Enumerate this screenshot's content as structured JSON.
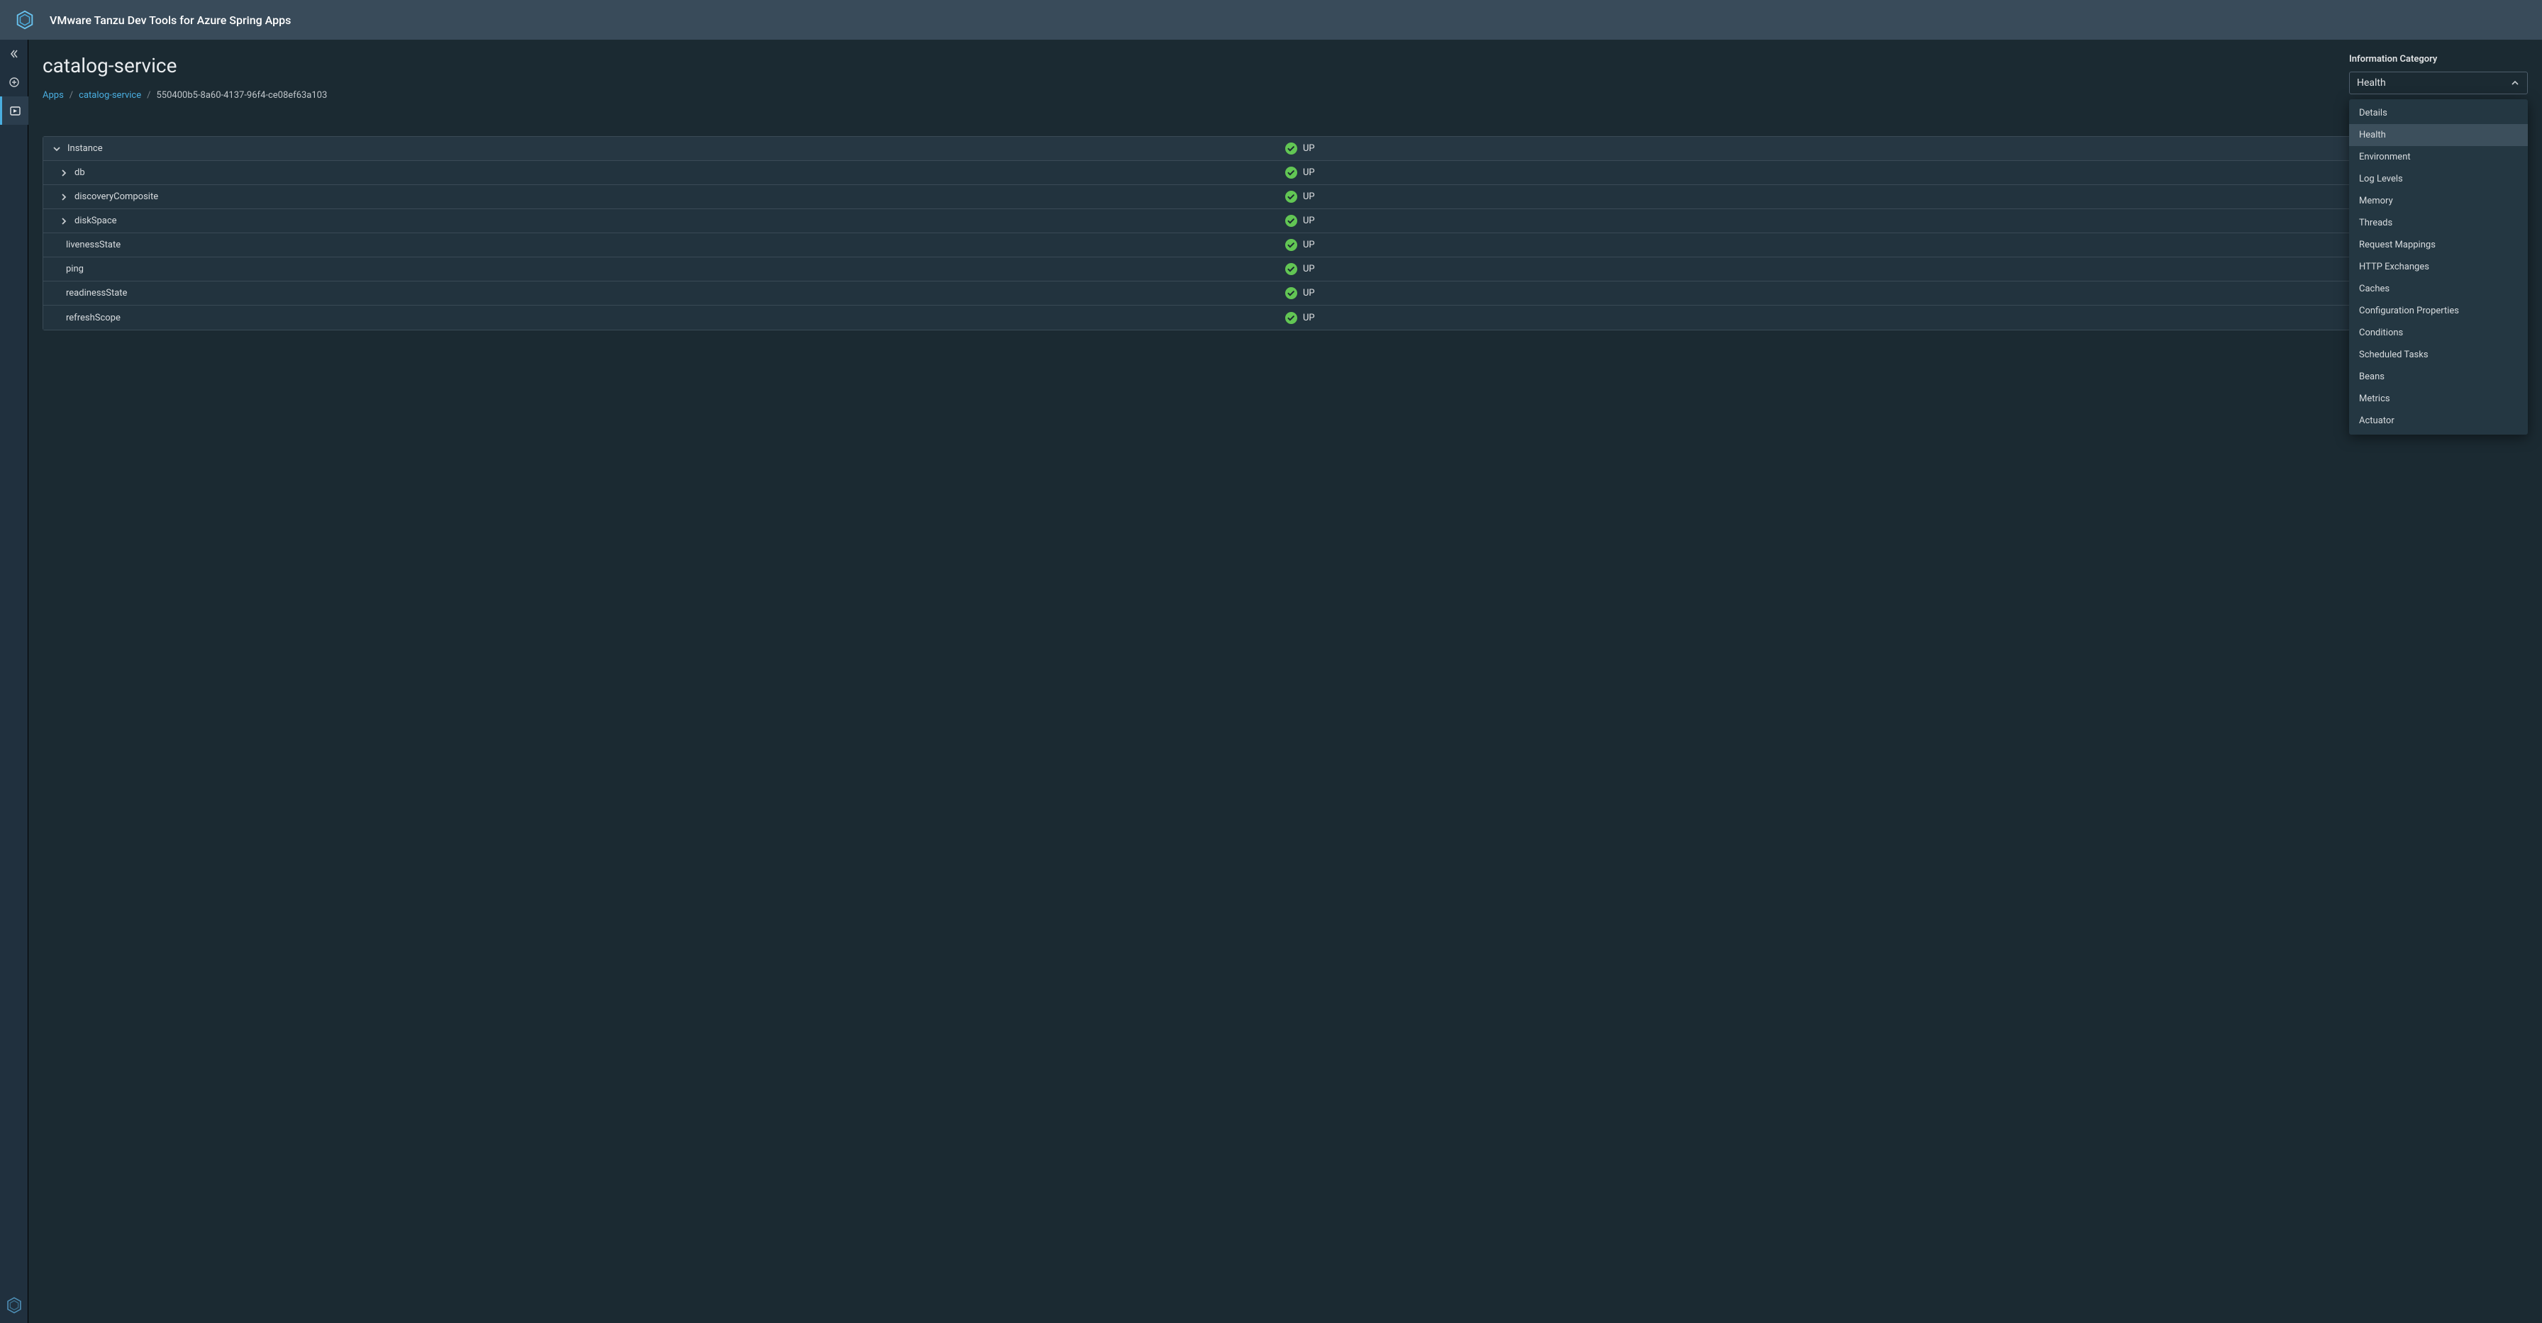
{
  "app_title": "VMware Tanzu Dev Tools for Azure Spring Apps",
  "page_title": "catalog-service",
  "breadcrumb": {
    "root": "Apps",
    "service": "catalog-service",
    "instance": "550400b5-8a60-4137-96f4-ce08ef63a103"
  },
  "info_category": {
    "label": "Information Category",
    "selected": "Health",
    "options": [
      "Details",
      "Health",
      "Environment",
      "Log Levels",
      "Memory",
      "Threads",
      "Request Mappings",
      "HTTP Exchanges",
      "Caches",
      "Configuration Properties",
      "Conditions",
      "Scheduled Tasks",
      "Beans",
      "Metrics",
      "Actuator"
    ]
  },
  "status_text": "UP",
  "health_rows": [
    {
      "name": "Instance",
      "expanded": true,
      "level": 0,
      "has_children": true
    },
    {
      "name": "db",
      "expanded": false,
      "level": 1,
      "has_children": true
    },
    {
      "name": "discoveryComposite",
      "expanded": false,
      "level": 1,
      "has_children": true
    },
    {
      "name": "diskSpace",
      "expanded": false,
      "level": 1,
      "has_children": true
    },
    {
      "name": "livenessState",
      "expanded": false,
      "level": 1,
      "has_children": false
    },
    {
      "name": "ping",
      "expanded": false,
      "level": 1,
      "has_children": false
    },
    {
      "name": "readinessState",
      "expanded": false,
      "level": 1,
      "has_children": false
    },
    {
      "name": "refreshScope",
      "expanded": false,
      "level": 1,
      "has_children": false
    }
  ],
  "colors": {
    "status_up": "#62c654"
  }
}
